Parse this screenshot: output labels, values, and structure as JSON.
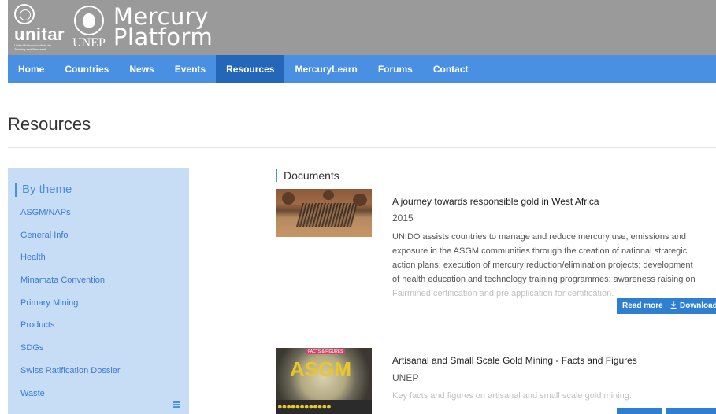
{
  "header": {
    "unitar_word": "unitar",
    "unitar_sub": "United Nations Institute for Training and Research",
    "unep_word": "UNEP",
    "platform_title": "Mercury\nPlatform"
  },
  "nav": {
    "items": [
      {
        "label": "Home"
      },
      {
        "label": "Countries"
      },
      {
        "label": "News"
      },
      {
        "label": "Events"
      },
      {
        "label": "Resources",
        "active": true
      },
      {
        "label": "MercuryLearn"
      },
      {
        "label": "Forums"
      },
      {
        "label": "Contact"
      }
    ]
  },
  "page": {
    "title": "Resources"
  },
  "sidebar": {
    "heading": "By theme",
    "items": [
      {
        "label": "ASGM/NAPs"
      },
      {
        "label": "General Info"
      },
      {
        "label": "Health"
      },
      {
        "label": "Minamata Convention"
      },
      {
        "label": "Primary Mining"
      },
      {
        "label": "Products"
      },
      {
        "label": "SDGs"
      },
      {
        "label": "Swiss Ratification Dossier"
      },
      {
        "label": "Waste"
      }
    ]
  },
  "documents": {
    "heading": "Documents",
    "items": [
      {
        "title": "A journey towards responsible gold in West Africa",
        "meta": "2015",
        "description_lines": [
          "UNIDO assists countries to manage and reduce mercury use, emissions and",
          "exposure in the ASGM communities through the creation of national strategic",
          "action plans; execution of mercury reduction/elimination projects; development",
          "of health education and technology training programmes; awareness raising on",
          "Fairmined certification and pre application for certification."
        ],
        "read_more": "Read more",
        "download": "Download"
      },
      {
        "title": "Artisanal and Small Scale Gold Mining - Facts and Figures",
        "meta": "UNEP",
        "description_lines": [
          "Key facts and figures on artisanal and small scale gold mining."
        ],
        "thumb_text": "ASGM",
        "thumb_tag": "FACTS & FIGURES"
      }
    ]
  },
  "colors": {
    "header_bg": "#9a9a9a",
    "nav_bg": "#4a90e2",
    "nav_active": "#2467b8",
    "sidebar_bg": "#c7dcf5",
    "link": "#3a7bd5",
    "button": "#2f7fd1"
  },
  "icons": {
    "un_emblem": "un-emblem-icon",
    "unep_emblem": "unep-emblem-icon",
    "download": "download-icon",
    "menu": "hamburger-menu-icon"
  }
}
